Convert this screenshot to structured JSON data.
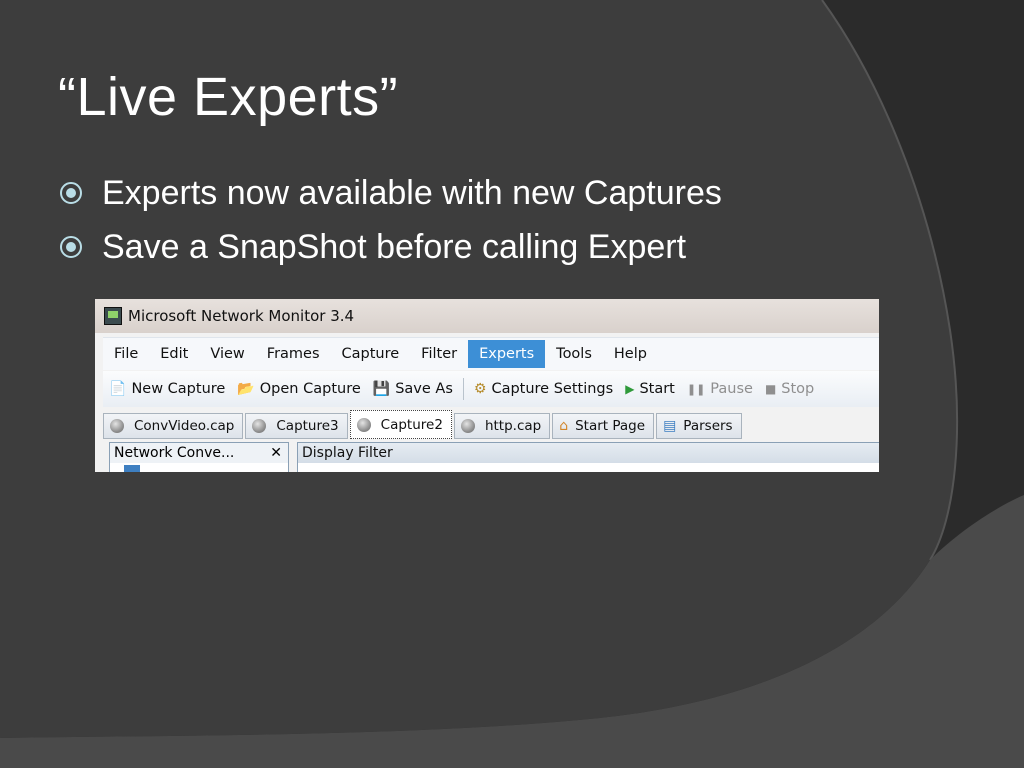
{
  "slide": {
    "title": "“Live Experts”",
    "bullets": [
      "Experts now available with new Captures",
      "Save a SnapShot before calling Expert"
    ]
  },
  "screenshot": {
    "window_title": "Microsoft Network Monitor 3.4",
    "menu": [
      "File",
      "Edit",
      "View",
      "Frames",
      "Capture",
      "Filter",
      "Experts",
      "Tools",
      "Help"
    ],
    "active_menu": "Experts",
    "toolbar": {
      "new_capture": "New Capture",
      "open_capture": "Open Capture",
      "save_as": "Save As",
      "capture_settings": "Capture Settings",
      "start": "Start",
      "pause": "Pause",
      "stop": "Stop"
    },
    "tabs": [
      "ConvVideo.cap",
      "Capture3",
      "Capture2",
      "http.cap",
      "Start Page",
      "Parsers"
    ],
    "active_tab": "Capture2",
    "left_panel": {
      "title": "Network Conve...",
      "close": "✕"
    },
    "right_panel": {
      "title": "Display Filter"
    }
  },
  "colors": {
    "background": "#3a3a3a",
    "bullet": "#b9dde6",
    "menu_highlight": "#3d8fd6"
  }
}
